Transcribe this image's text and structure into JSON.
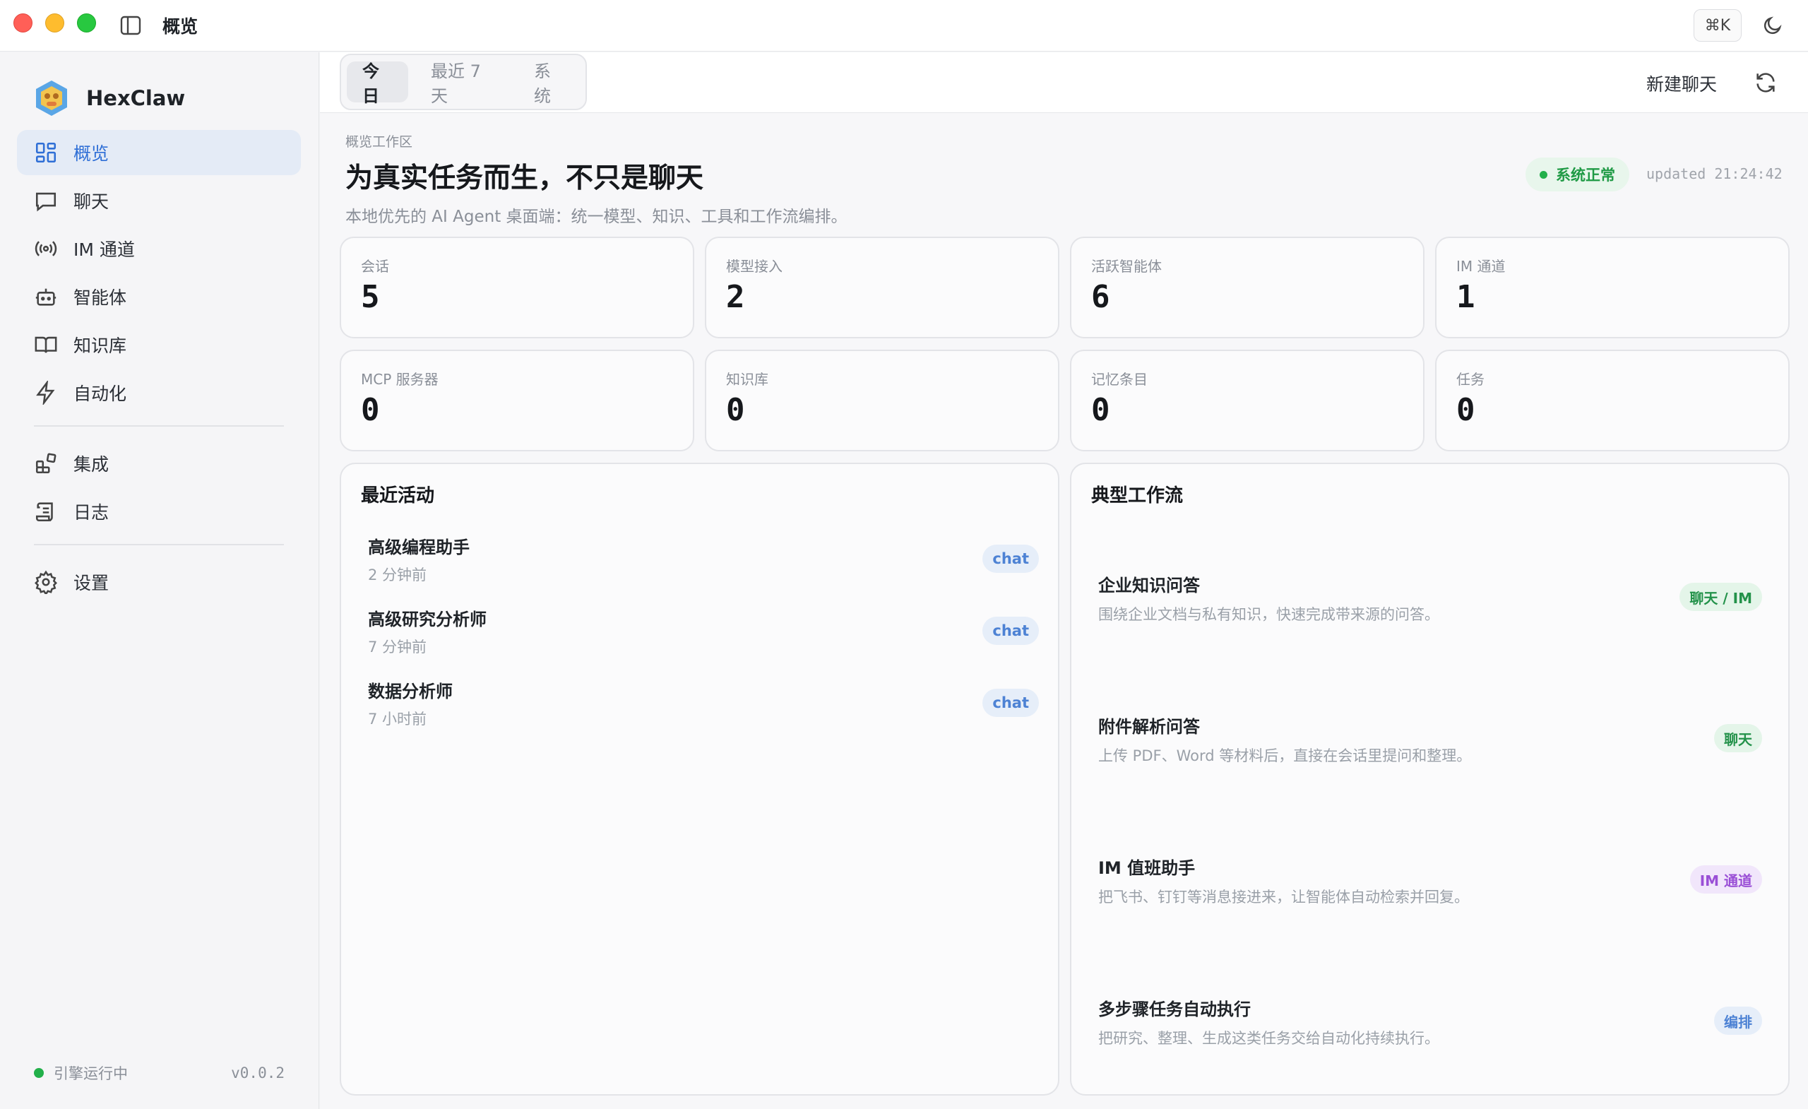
{
  "window": {
    "title": "概览",
    "shortcut": "⌘K"
  },
  "sidebar": {
    "brand": "HexClaw",
    "items": [
      {
        "label": "概览",
        "icon": "dashboard-icon"
      },
      {
        "label": "聊天",
        "icon": "chat-icon"
      },
      {
        "label": "IM 通道",
        "icon": "broadcast-icon"
      },
      {
        "label": "智能体",
        "icon": "robot-icon"
      },
      {
        "label": "知识库",
        "icon": "book-icon"
      },
      {
        "label": "自动化",
        "icon": "lightning-icon"
      },
      {
        "label": "集成",
        "icon": "integration-icon"
      },
      {
        "label": "日志",
        "icon": "log-icon"
      },
      {
        "label": "设置",
        "icon": "gear-icon"
      }
    ],
    "engine_status": "引擎运行中",
    "version": "v0.0.2"
  },
  "topbar": {
    "tabs": [
      "今日",
      "最近 7 天",
      "系统"
    ],
    "new_chat": "新建聊天"
  },
  "hero": {
    "kicker": "概览工作区",
    "title": "为真实任务而生，不只是聊天",
    "subtitle": "本地优先的 AI Agent 桌面端：统一模型、知识、工具和工作流编排。",
    "status": "系统正常",
    "updated": "updated 21:24:42"
  },
  "stats": [
    {
      "label": "会话",
      "value": "5"
    },
    {
      "label": "模型接入",
      "value": "2"
    },
    {
      "label": "活跃智能体",
      "value": "6"
    },
    {
      "label": "IM 通道",
      "value": "1"
    },
    {
      "label": "MCP 服务器",
      "value": "0"
    },
    {
      "label": "知识库",
      "value": "0"
    },
    {
      "label": "记忆条目",
      "value": "0"
    },
    {
      "label": "任务",
      "value": "0"
    }
  ],
  "activity": {
    "title": "最近活动",
    "items": [
      {
        "title": "高级编程助手",
        "time": "2 分钟前",
        "tag": "chat"
      },
      {
        "title": "高级研究分析师",
        "time": "7 分钟前",
        "tag": "chat"
      },
      {
        "title": "数据分析师",
        "time": "7 小时前",
        "tag": "chat"
      }
    ]
  },
  "workflows": {
    "title": "典型工作流",
    "items": [
      {
        "title": "企业知识问答",
        "desc": "围绕企业文档与私有知识，快速完成带来源的问答。",
        "tag": "聊天 / IM"
      },
      {
        "title": "附件解析问答",
        "desc": "上传 PDF、Word 等材料后，直接在会话里提问和整理。",
        "tag": "聊天"
      },
      {
        "title": "IM 值班助手",
        "desc": "把飞书、钉钉等消息接进来，让智能体自动检索并回复。",
        "tag": "IM 通道"
      },
      {
        "title": "多步骤任务自动执行",
        "desc": "把研究、整理、生成这类任务交给自动化持续执行。",
        "tag": "编排"
      }
    ]
  }
}
